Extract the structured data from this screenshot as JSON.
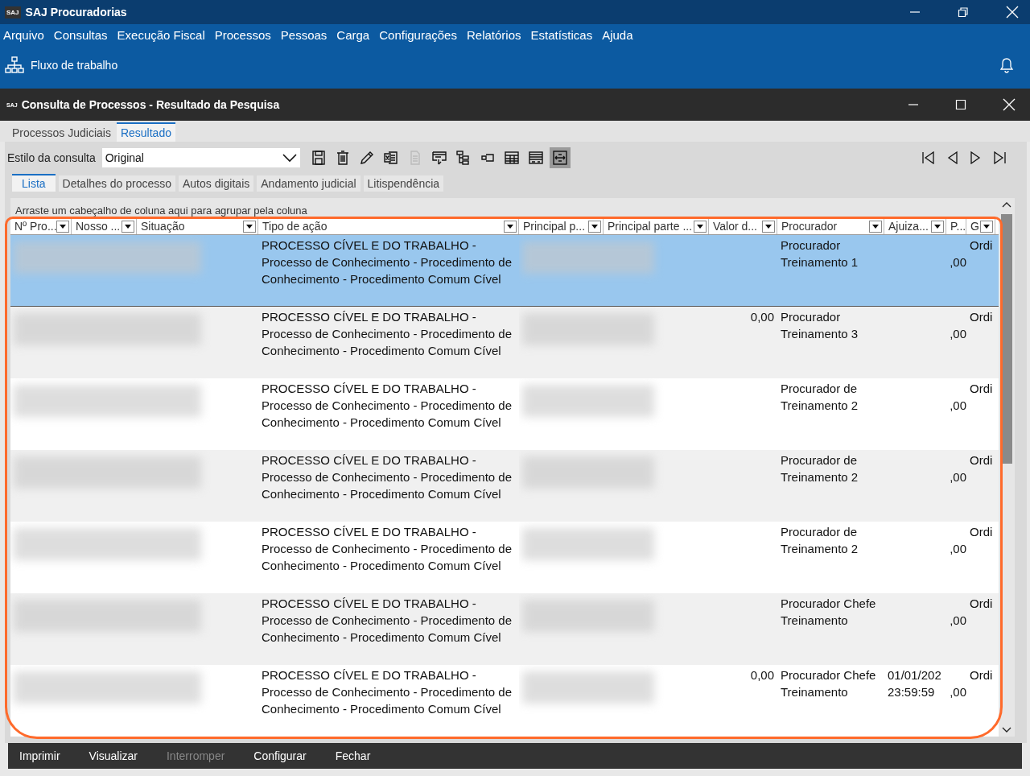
{
  "app_window": {
    "title": "SAJ Procuradorias",
    "logo": "SAJ"
  },
  "menu": [
    "Arquivo",
    "Consultas",
    "Execução Fiscal",
    "Processos",
    "Pessoas",
    "Carga",
    "Configurações",
    "Relatórios",
    "Estatísticas",
    "Ajuda"
  ],
  "workflow_button": {
    "label": "Fluxo de trabalho"
  },
  "inner_window": {
    "title": "Consulta de Processos - Resultado da Pesquisa",
    "logo": "SAJ"
  },
  "tabs": [
    {
      "label": "Processos Judiciais",
      "selected": false
    },
    {
      "label": "Resultado",
      "selected": true
    }
  ],
  "style_field": {
    "label": "Estilo da consulta",
    "value": "Original"
  },
  "toolbar": [
    {
      "kind": "save",
      "disabled": false,
      "pressed": false
    },
    {
      "kind": "trash",
      "disabled": false,
      "pressed": false
    },
    {
      "kind": "pencil",
      "disabled": false,
      "pressed": false
    },
    {
      "kind": "spreadsheet",
      "disabled": false,
      "pressed": false
    },
    {
      "kind": "document",
      "disabled": true,
      "pressed": false
    },
    {
      "kind": "window",
      "disabled": false,
      "pressed": false
    },
    {
      "kind": "tree",
      "disabled": false,
      "pressed": false
    },
    {
      "kind": "columns",
      "disabled": false,
      "pressed": false
    },
    {
      "kind": "table",
      "disabled": false,
      "pressed": false
    },
    {
      "kind": "list",
      "disabled": false,
      "pressed": false
    },
    {
      "kind": "fit",
      "disabled": false,
      "pressed": true
    }
  ],
  "sub_tabs": [
    {
      "label": "Lista",
      "selected": true
    },
    {
      "label": "Detalhes do processo",
      "selected": false
    },
    {
      "label": "Autos digitais",
      "selected": false
    },
    {
      "label": "Andamento judicial",
      "selected": false
    },
    {
      "label": "Litispendência",
      "selected": false
    }
  ],
  "group_hint": "Arraste um cabeçalho de coluna aqui para agrupar pela coluna",
  "table": {
    "columns": [
      "Nº Pro...",
      "Nosso ...",
      "Situação",
      "Tipo de ação",
      "Principal p...",
      "Principal parte ...",
      "Valor d...",
      "Procurador",
      "Ajuiza...",
      "P...",
      "G"
    ],
    "rows": [
      {
        "selected": true,
        "tipo": "PROCESSO CÍVEL E DO TRABALHO - Processo de Conhecimento - Procedimento de Conhecimento - Procedimento Comum Cível",
        "valor": "",
        "procurador": "Procurador Treinamento 1",
        "ajuizamento": "",
        "column_10": ",00",
        "column_11": "Ordi"
      },
      {
        "selected": false,
        "tipo": "PROCESSO CÍVEL E DO TRABALHO - Processo de Conhecimento - Procedimento de Conhecimento - Procedimento Comum Cível",
        "valor": "0,00",
        "procurador": "Procurador Treinamento 3",
        "ajuizamento": "",
        "column_10": ",00",
        "column_11": "Ordi"
      },
      {
        "selected": false,
        "tipo": "PROCESSO CÍVEL E DO TRABALHO - Processo de Conhecimento - Procedimento de Conhecimento - Procedimento Comum Cível",
        "valor": "",
        "procurador": "Procurador de Treinamento 2",
        "ajuizamento": "",
        "column_10": ",00",
        "column_11": "Ordi"
      },
      {
        "selected": false,
        "tipo": "PROCESSO CÍVEL E DO TRABALHO - Processo de Conhecimento - Procedimento de Conhecimento - Procedimento Comum Cível",
        "valor": "",
        "procurador": "Procurador de Treinamento 2",
        "ajuizamento": "",
        "column_10": ",00",
        "column_11": "Ordi"
      },
      {
        "selected": false,
        "tipo": "PROCESSO CÍVEL E DO TRABALHO - Processo de Conhecimento - Procedimento de Conhecimento - Procedimento Comum Cível",
        "valor": "",
        "procurador": "Procurador de Treinamento 2",
        "ajuizamento": "",
        "column_10": ",00",
        "column_11": "Ordi"
      },
      {
        "selected": false,
        "tipo": "PROCESSO CÍVEL E DO TRABALHO - Processo de Conhecimento - Procedimento de Conhecimento - Procedimento Comum Cível",
        "valor": "",
        "procurador": "Procurador Chefe Treinamento",
        "ajuizamento": "",
        "column_10": ",00",
        "column_11": "Ordi"
      },
      {
        "selected": false,
        "tipo": "PROCESSO CÍVEL E DO TRABALHO - Processo de Conhecimento - Procedimento de Conhecimento - Procedimento Comum Cível",
        "valor": "0,00",
        "procurador": "Procurador Chefe Treinamento",
        "ajuizamento": "01/01/202 23:59:59",
        "column_10": ",00",
        "column_11": "Ordi"
      }
    ]
  },
  "footer_buttons": [
    {
      "label": "Imprimir",
      "disabled": false
    },
    {
      "label": "Visualizar",
      "disabled": false
    },
    {
      "label": "Interromper",
      "disabled": true
    },
    {
      "label": "Configurar",
      "disabled": false
    },
    {
      "label": "Fechar",
      "disabled": false
    }
  ]
}
